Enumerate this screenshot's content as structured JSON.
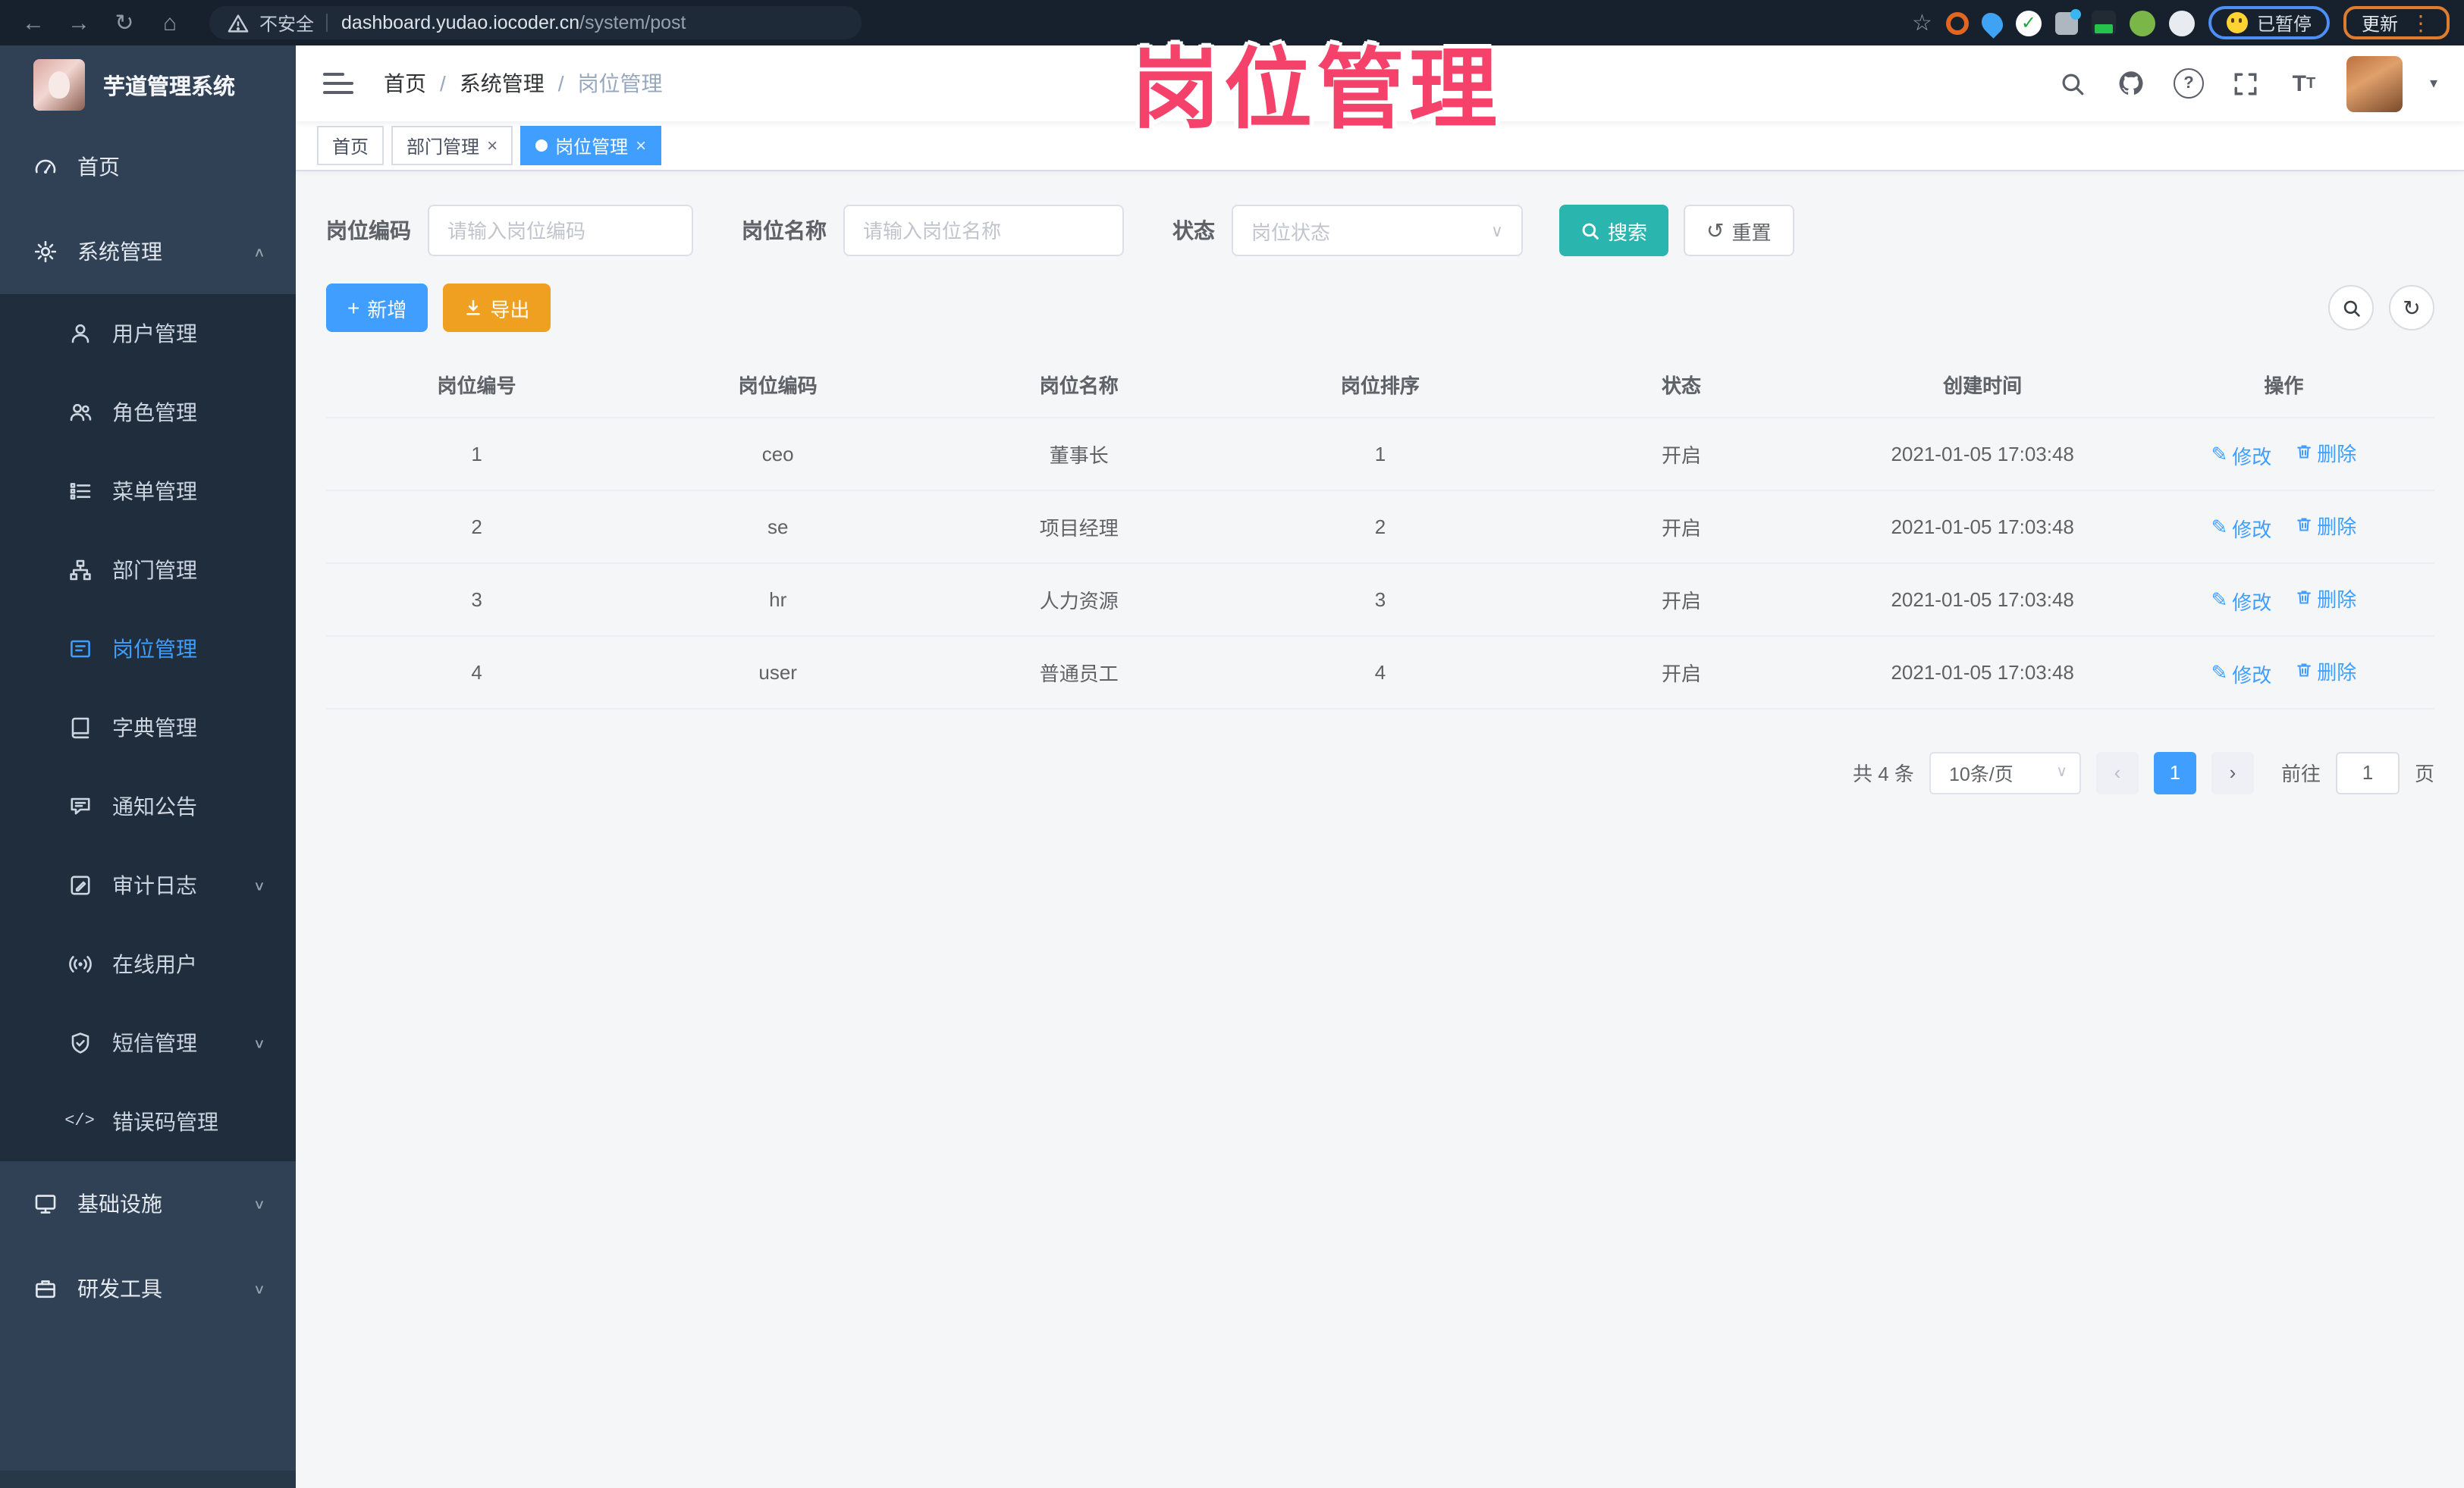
{
  "browser": {
    "security_label": "不安全",
    "url_host": "dashboard.yudao.iocoder.cn",
    "url_path": "/system/post",
    "paused_badge": "已暂停",
    "update_button": "更新"
  },
  "watermark": "岗位管理",
  "sidebar": {
    "app_title": "芋道管理系统",
    "items": [
      {
        "key": "home",
        "label": "首页",
        "icon": "gauge-icon",
        "level": 1
      },
      {
        "key": "system",
        "label": "系统管理",
        "icon": "gear-icon",
        "level": 1,
        "arrow": "up"
      },
      {
        "key": "user",
        "label": "用户管理",
        "icon": "user-icon",
        "level": 2
      },
      {
        "key": "role",
        "label": "角色管理",
        "icon": "role-icon",
        "level": 2
      },
      {
        "key": "menu",
        "label": "菜单管理",
        "icon": "menu-icon",
        "level": 2
      },
      {
        "key": "dept",
        "label": "部门管理",
        "icon": "tree-icon",
        "level": 2
      },
      {
        "key": "post",
        "label": "岗位管理",
        "icon": "post-icon",
        "level": 2,
        "active": true
      },
      {
        "key": "dict",
        "label": "字典管理",
        "icon": "dict-icon",
        "level": 2
      },
      {
        "key": "notice",
        "label": "通知公告",
        "icon": "notice-icon",
        "level": 2
      },
      {
        "key": "auditlog",
        "label": "审计日志",
        "icon": "log-icon",
        "level": 2,
        "arrow": "down"
      },
      {
        "key": "online",
        "label": "在线用户",
        "icon": "online-icon",
        "level": 2
      },
      {
        "key": "sms",
        "label": "短信管理",
        "icon": "sms-icon",
        "level": 2,
        "arrow": "down"
      },
      {
        "key": "errcode",
        "label": "错误码管理",
        "icon": "code-icon",
        "level": 2
      },
      {
        "key": "infra",
        "label": "基础设施",
        "icon": "infra-icon",
        "level": 1,
        "arrow": "down"
      },
      {
        "key": "devtools",
        "label": "研发工具",
        "icon": "tools-icon",
        "level": 1,
        "arrow": "down"
      }
    ]
  },
  "navbar": {
    "breadcrumb": [
      "首页",
      "系统管理",
      "岗位管理"
    ]
  },
  "tabs": [
    {
      "label": "首页"
    },
    {
      "label": "部门管理"
    },
    {
      "label": "岗位管理"
    }
  ],
  "filters": {
    "post_code_label": "岗位编码",
    "post_code_placeholder": "请输入岗位编码",
    "post_name_label": "岗位名称",
    "post_name_placeholder": "请输入岗位名称",
    "status_label": "状态",
    "status_placeholder": "岗位状态",
    "search_button": "搜索",
    "reset_button": "重置"
  },
  "toolbar": {
    "add_button": "新增",
    "export_button": "导出"
  },
  "table": {
    "headers": [
      "岗位编号",
      "岗位编码",
      "岗位名称",
      "岗位排序",
      "状态",
      "创建时间",
      "操作"
    ],
    "rows": [
      {
        "id": "1",
        "code": "ceo",
        "name": "董事长",
        "sort": "1",
        "status": "开启",
        "created": "2021-01-05 17:03:48"
      },
      {
        "id": "2",
        "code": "se",
        "name": "项目经理",
        "sort": "2",
        "status": "开启",
        "created": "2021-01-05 17:03:48"
      },
      {
        "id": "3",
        "code": "hr",
        "name": "人力资源",
        "sort": "3",
        "status": "开启",
        "created": "2021-01-05 17:03:48"
      },
      {
        "id": "4",
        "code": "user",
        "name": "普通员工",
        "sort": "4",
        "status": "开启",
        "created": "2021-01-05 17:03:48"
      }
    ],
    "action_edit": "修改",
    "action_delete": "删除"
  },
  "pagination": {
    "total_text": "共 4 条",
    "page_size": "10条/页",
    "current_page": "1",
    "goto_label": "前往",
    "goto_value": "1",
    "page_suffix": "页"
  }
}
